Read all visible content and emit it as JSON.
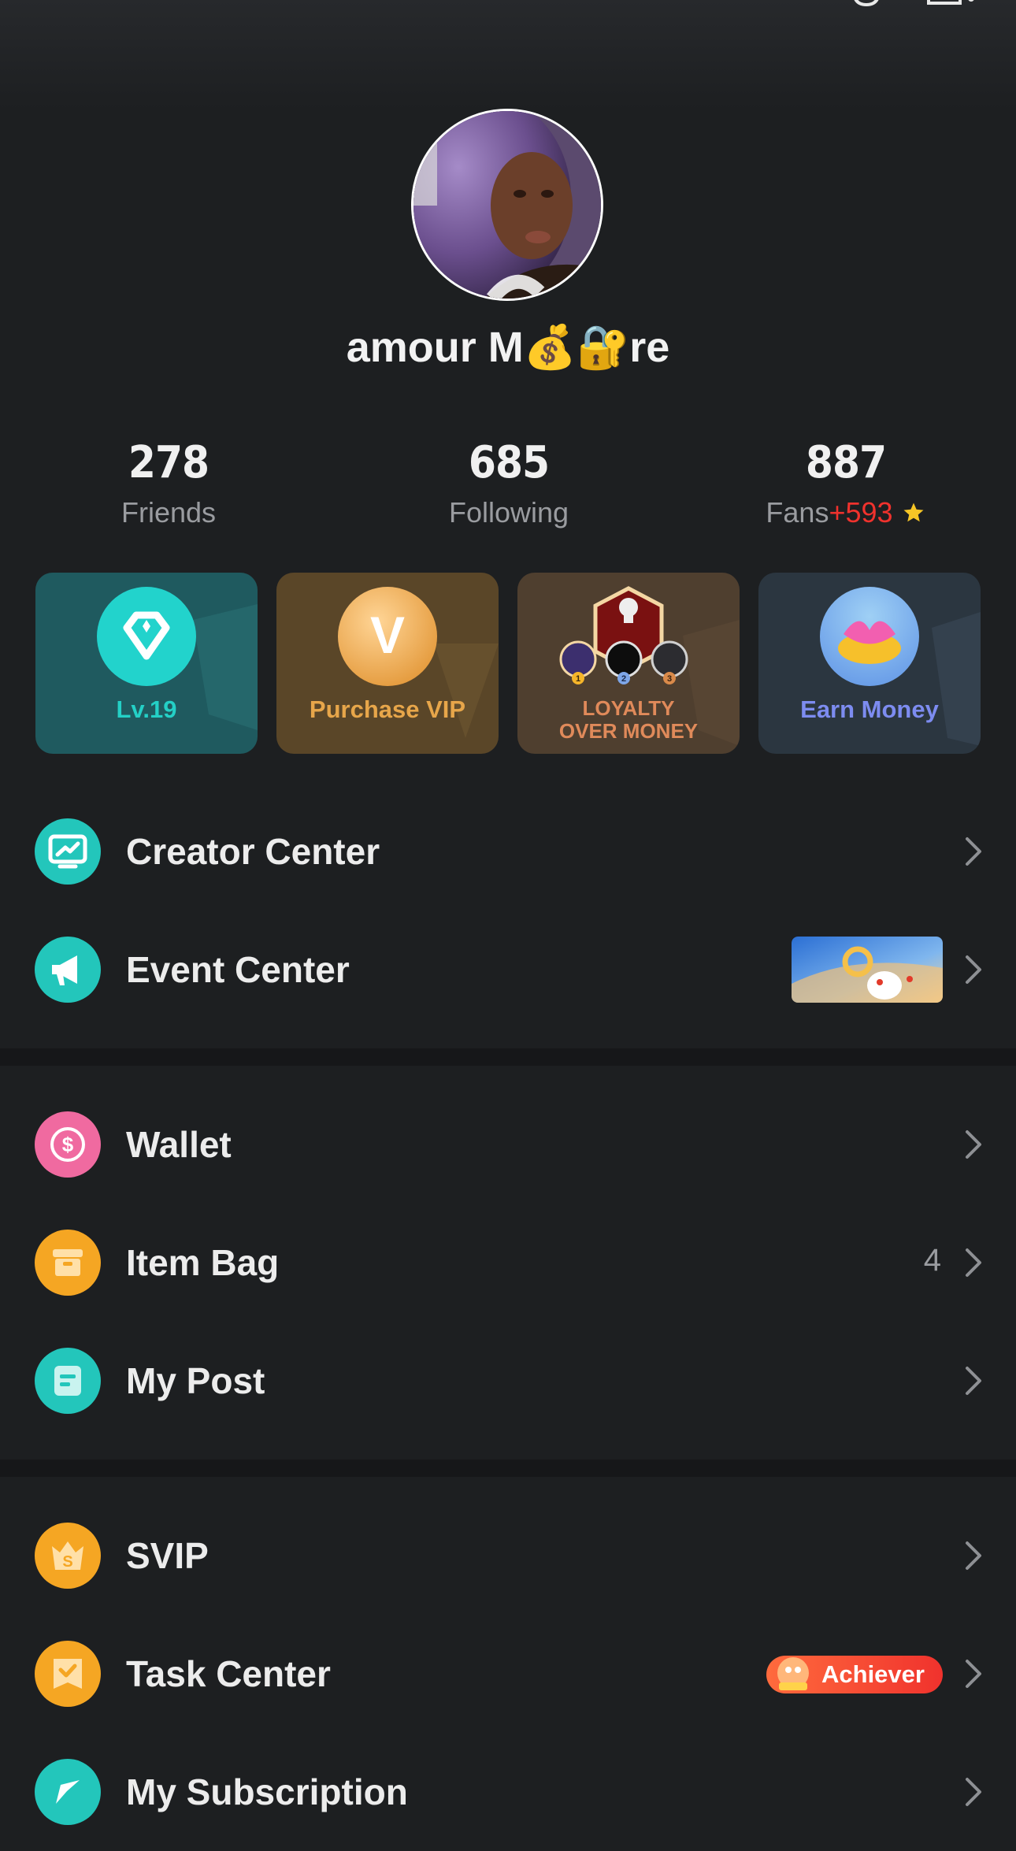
{
  "profile": {
    "username": "amour M💰🔐re",
    "avatar": "avatar-photo"
  },
  "stats": [
    {
      "value": "278",
      "label": "Friends"
    },
    {
      "value": "685",
      "label": "Following"
    },
    {
      "value": "887",
      "label": "Fans",
      "plus": "+593"
    }
  ],
  "cards": {
    "level": "Lv.19",
    "vip": "Purchase VIP",
    "vip_glyph": "V",
    "family_line1": "LOYALTY",
    "family_line2": "OVER MONEY",
    "family_ranks": [
      "1",
      "2",
      "3"
    ],
    "earn": "Earn Money"
  },
  "menu_group1": {
    "creator": "Creator Center",
    "event": "Event Center"
  },
  "menu_group2": {
    "wallet": "Wallet",
    "itembag": "Item Bag",
    "itembag_count": "4",
    "mypost": "My Post"
  },
  "menu_group3": {
    "svip": "SVIP",
    "task": "Task Center",
    "task_badge": "Achiever",
    "subscription": "My Subscription"
  },
  "colors": {
    "background": "#1d1f21",
    "teal": "#23c6bb",
    "orange": "#f5a623",
    "pink": "#f06aa0",
    "red": "#f0322d",
    "vip_gold": "#e7a64a",
    "earn_blue": "#7d8cf0"
  }
}
